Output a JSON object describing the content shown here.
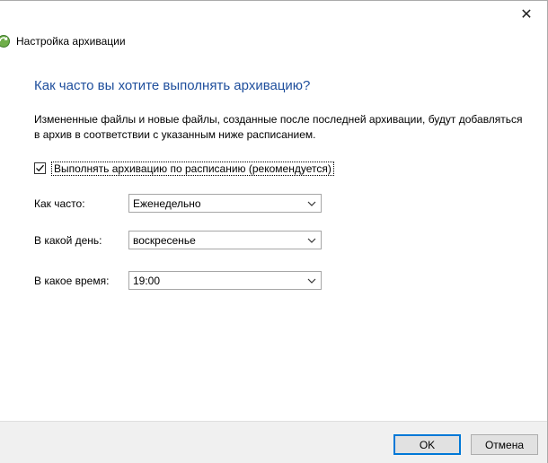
{
  "window": {
    "close_glyph": "✕"
  },
  "header": {
    "title": "Настройка архивации",
    "icon": "backup-icon"
  },
  "heading": "Как часто вы хотите выполнять архивацию?",
  "description": "Измененные файлы и новые файлы, созданные после последней архивации, будут добавляться в архив в соответствии с указанным ниже расписанием.",
  "schedule": {
    "checkbox_label": "Выполнять архивацию по расписанию (рекомендуется)",
    "checked": true
  },
  "fields": {
    "frequency": {
      "label": "Как часто:",
      "value": "Еженедельно"
    },
    "day": {
      "label": "В какой день:",
      "value": "воскресенье"
    },
    "time": {
      "label": "В какое время:",
      "value": "19:00"
    }
  },
  "buttons": {
    "ok": "OK",
    "cancel": "Отмена"
  },
  "colors": {
    "heading": "#1e4e9c",
    "accent": "#0078d7"
  }
}
